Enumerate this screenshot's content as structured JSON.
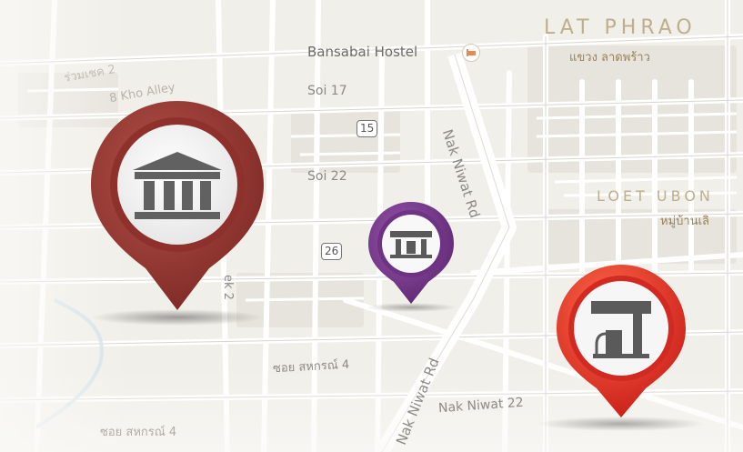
{
  "map": {
    "districts": [
      {
        "name": "LAT PHRAO",
        "thai": "แขวง ลาดพร้าว"
      },
      {
        "name": "LOET UBON",
        "thai": "หมู่บ้านเลิ"
      }
    ],
    "poi": {
      "label": "Bansabai Hostel"
    },
    "streets": {
      "nak_niwat_rd_top": "Nak Niwat Rd",
      "nak_niwat_rd_bottom": "Nak Niwat Rd",
      "nak_niwat_22": "Nak Niwat 22",
      "soi_17": "Soi 17",
      "soi_22": "Soi 22",
      "khu_alley": "8 Kho Alley",
      "soi_thai_top": "ร่วมเชค 2",
      "sahakorn_4_mid": "ซอย สหกรณ์ 4",
      "sahakorn_4_bottom": "ซอย สหกรณ์ 4",
      "ek_2": "ek 2"
    },
    "route_shields": [
      "15",
      "26"
    ],
    "pins": [
      {
        "type": "bank",
        "icon": "bank-icon",
        "color": "#9b3b35"
      },
      {
        "type": "gas-station",
        "icon": "gas-station-icon",
        "color": "#7a3a8e"
      },
      {
        "type": "fuel-pump",
        "icon": "fuel-pump-icon",
        "color": "#e3352a"
      }
    ]
  }
}
